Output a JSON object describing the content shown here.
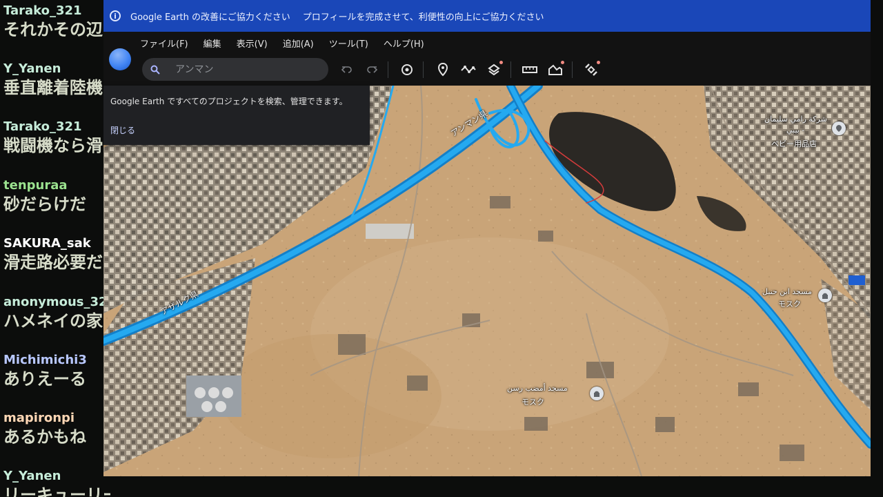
{
  "chat": {
    "messages": [
      {
        "user": "Tarako_321",
        "text": "それかその辺",
        "user_color": "#c7ecd9"
      },
      {
        "user": "Y_Yanen",
        "text": "垂直離着陸機",
        "user_color": "#c7ecd9"
      },
      {
        "user": "Tarako_321",
        "text": "戦闘機なら滑",
        "user_color": "#c7ecd9"
      },
      {
        "user": "tenpuraa",
        "text": "砂だらけだ",
        "user_color": "#9be28f"
      },
      {
        "user": "SAKURA_sak",
        "text": "滑走路必要だ",
        "user_color": "#ffffff"
      },
      {
        "user": "anonymous_32",
        "text": "ハメネイの家",
        "user_color": "#c7ecd9"
      },
      {
        "user": "Michimichi3",
        "text": "ありえーる",
        "user_color": "#b8c7ff"
      },
      {
        "user": "mapironpi",
        "text": "あるかもね",
        "user_color": "#ffd7b5"
      },
      {
        "user": "Y_Yanen",
        "text": "リーキューリーブ",
        "user_color": "#c7ecd9"
      }
    ]
  },
  "banner": {
    "info_icon": "info-icon",
    "message": "Google Earth の改善にご協力ください",
    "link": "プロフィールを完成させて、利便性の向上にご協力ください",
    "color": "#1a47b8"
  },
  "menu": {
    "items": [
      "ファイル(F)",
      "編集",
      "表示(V)",
      "追加(A)",
      "ツール(T)",
      "ヘルプ(H)"
    ]
  },
  "toolbar": {
    "search_placeholder": "アンマン",
    "buttons": [
      "undo-icon",
      "redo-icon",
      "history-icon",
      "placemark-icon",
      "path-icon",
      "layers-icon",
      "ruler-icon",
      "elevation-icon",
      "satellite-icon"
    ]
  },
  "tooltip": {
    "text": "Google Earth ですべてのプロジェクトを検索、管理できます。",
    "close": "閉じる"
  },
  "map": {
    "labels": {
      "road_amman": "アンマン県",
      "road_azraq": "アザルク県",
      "place_rami_ar": "شركة رامي سليمان",
      "place_rami_ar2": "بيبي -",
      "place_rami_jp": "ベビー用品店",
      "mosque_hanbal_ar": "مسجد ابن حنبل",
      "mosque_hanbal_jp": "モスク",
      "mosque_2_ar": "مسجد أمضب رسن",
      "mosque_2_jp": "モスク"
    },
    "road_color": "#25a9f0",
    "ground_color": "#c9a478"
  }
}
